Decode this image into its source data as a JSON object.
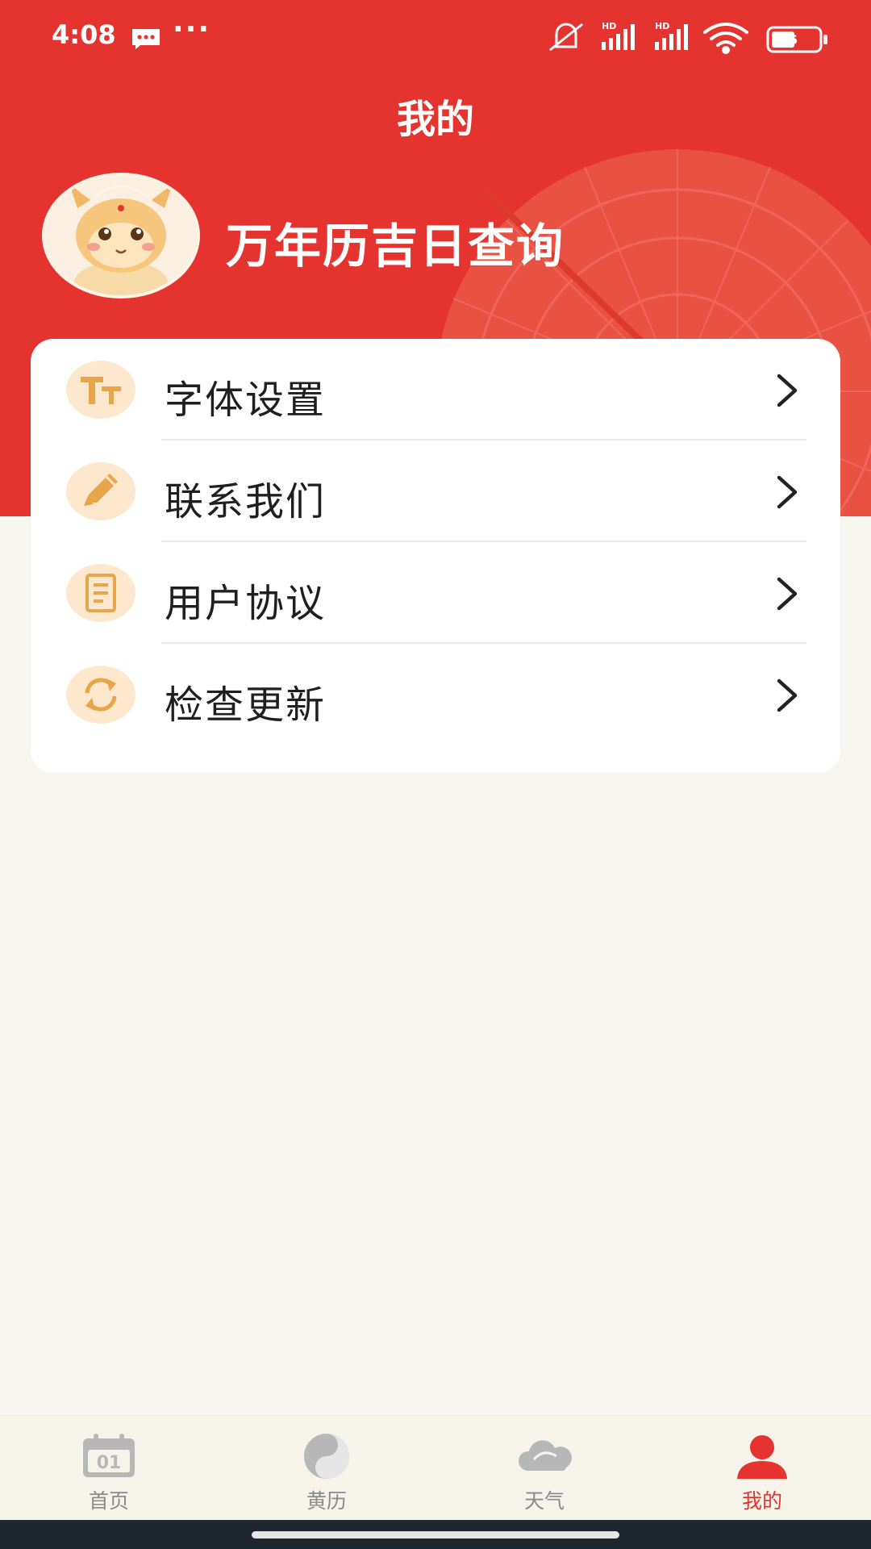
{
  "status_bar": {
    "time": "4:08",
    "dots": "···",
    "battery_level": "5"
  },
  "header": {
    "title": "我的",
    "profile_name": "万年历吉日查询"
  },
  "menu": {
    "items": [
      {
        "label": "字体设置",
        "icon": "font-size-icon"
      },
      {
        "label": "联系我们",
        "icon": "pencil-icon"
      },
      {
        "label": "用户协议",
        "icon": "document-icon"
      },
      {
        "label": "检查更新",
        "icon": "refresh-icon"
      }
    ]
  },
  "tab_bar": {
    "tabs": [
      {
        "label": "首页",
        "icon": "calendar-icon",
        "icon_text": "01"
      },
      {
        "label": "黄历",
        "icon": "yin-yang-icon"
      },
      {
        "label": "天气",
        "icon": "cloud-icon"
      },
      {
        "label": "我的",
        "icon": "person-icon"
      }
    ],
    "active_index": 3
  },
  "colors": {
    "header_red": "#e5332f",
    "icon_bg": "#fde7cd",
    "icon_orange": "#e9a54a",
    "tab_active": "#e5332f",
    "tab_inactive": "#b7b7b7"
  }
}
